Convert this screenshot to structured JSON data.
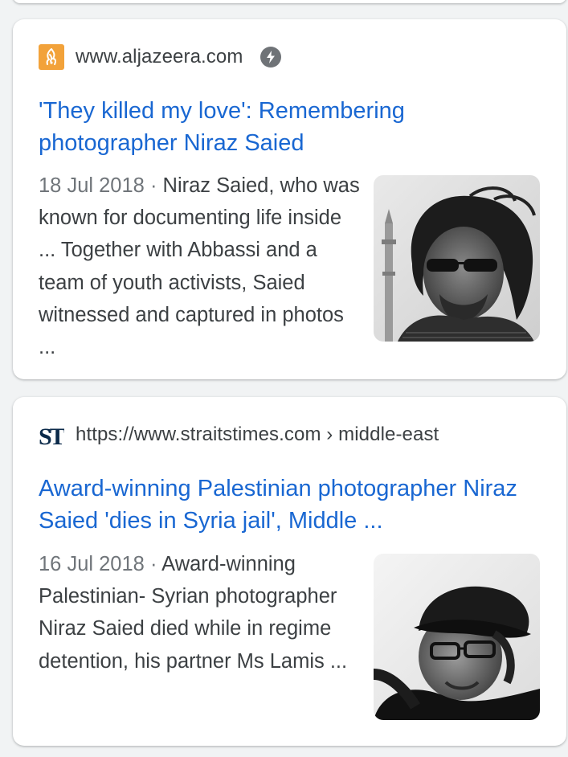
{
  "results": [
    {
      "source_url": "www.aljazeera.com",
      "favicon_icon": "aljazeera-logo",
      "amp_icon": "amp-lightning-icon",
      "title": "'They killed my love': Remembering photographer Niraz Saied",
      "date": "18 Jul 2018",
      "separator": "·",
      "snippet": "Niraz Saied, who was known for documenting life inside ... Together with Abbassi and a team of youth activists, Saied witnessed and captured in photos ...",
      "thumbnail_icon": "portrait-with-sunglasses-photo"
    },
    {
      "source_url": "https://www.straitstimes.com › middle-east",
      "favicon_icon": "straits-times-logo",
      "title": "Award-winning Palestinian photographer Niraz Saied 'dies in Syria jail', Middle ...",
      "date": "16 Jul 2018",
      "separator": "·",
      "snippet": "Award-winning Palestinian- Syrian photographer Niraz Saied died while in regime detention, his partner Ms Lamis ...",
      "thumbnail_icon": "portrait-with-cap-photo"
    }
  ],
  "colors": {
    "title_link": "#1967d2",
    "body_text": "#3c4043",
    "muted_text": "#70757a",
    "background": "#f1f3f4",
    "aljazeera_orange": "#f2a23a"
  }
}
